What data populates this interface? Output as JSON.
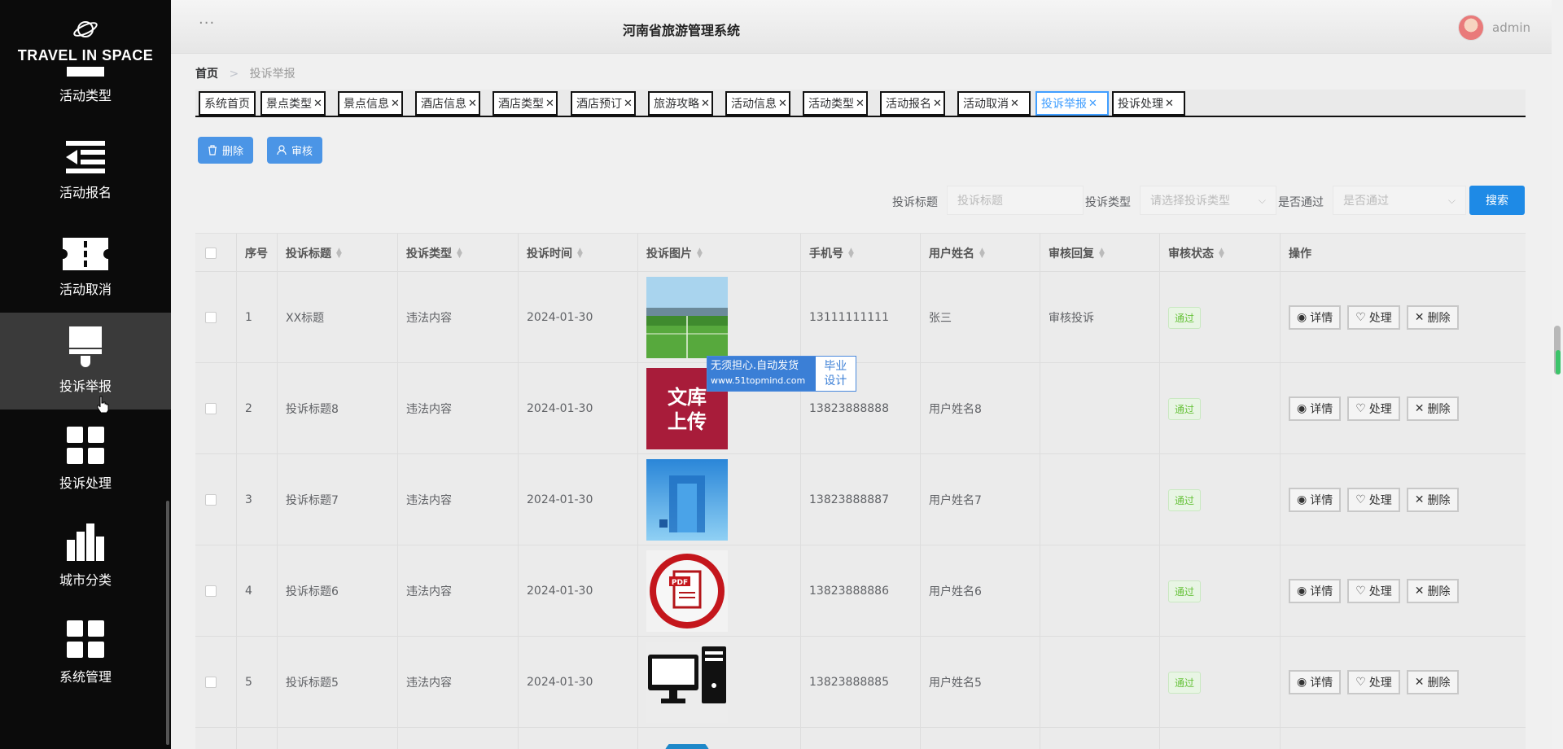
{
  "brand": {
    "name": "TRAVEL IN SPACE"
  },
  "sidebar": {
    "items": [
      {
        "label": "活动类型",
        "icon": "bar-icon"
      },
      {
        "label": "活动报名",
        "icon": "indent-list-icon"
      },
      {
        "label": "活动取消",
        "icon": "ticket-icon"
      },
      {
        "label": "投诉举报",
        "icon": "brush-icon",
        "active": true
      },
      {
        "label": "投诉处理",
        "icon": "grid-icon"
      },
      {
        "label": "城市分类",
        "icon": "bar-chart-icon"
      },
      {
        "label": "系统管理",
        "icon": "grid-icon"
      }
    ]
  },
  "header": {
    "title": "河南省旅游管理系统",
    "user": "admin",
    "menu_glyph": "···"
  },
  "breadcrumb": {
    "home": "首页",
    "separator": ">",
    "current": "投诉举报"
  },
  "tabs": [
    {
      "label": "系统首页",
      "closable": false
    },
    {
      "label": "景点类型",
      "closable": true
    },
    {
      "label": "景点信息",
      "closable": true
    },
    {
      "label": "酒店信息",
      "closable": true
    },
    {
      "label": "酒店类型",
      "closable": true
    },
    {
      "label": "酒店预订",
      "closable": true
    },
    {
      "label": "旅游攻略",
      "closable": true
    },
    {
      "label": "活动信息",
      "closable": true
    },
    {
      "label": "活动类型",
      "closable": true
    },
    {
      "label": "活动报名",
      "closable": true
    },
    {
      "label": "活动取消",
      "closable": true
    },
    {
      "label": "投诉举报",
      "closable": true,
      "active": true
    },
    {
      "label": "投诉处理",
      "closable": true
    }
  ],
  "actions": {
    "delete_label": "删除",
    "review_label": "审核"
  },
  "search": {
    "title_label": "投诉标题",
    "title_placeholder": "投诉标题",
    "type_label": "投诉类型",
    "type_placeholder": "请选择投诉类型",
    "pass_label": "是否通过",
    "pass_placeholder": "是否通过",
    "button_label": "搜索"
  },
  "table": {
    "columns": [
      "序号",
      "投诉标题",
      "投诉类型",
      "投诉时间",
      "投诉图片",
      "手机号",
      "用户姓名",
      "审核回复",
      "审核状态",
      "操作"
    ],
    "rows": [
      {
        "index": "1",
        "title": "XX标题",
        "type": "违法内容",
        "time": "2024-01-30",
        "image": "stadium-image",
        "phone": "13111111111",
        "name": "张三",
        "reply": "审核投诉",
        "status": "通过"
      },
      {
        "index": "2",
        "title": "投诉标题8",
        "type": "违法内容",
        "time": "2024-01-30",
        "image": "wenku-upload-image",
        "image_text": "文库上传",
        "phone": "13823888888",
        "name": "用户姓名8",
        "reply": "",
        "status": "通过"
      },
      {
        "index": "3",
        "title": "投诉标题7",
        "type": "违法内容",
        "time": "2024-01-30",
        "image": "blue-stage-image",
        "phone": "13823888887",
        "name": "用户姓名7",
        "reply": "",
        "status": "通过"
      },
      {
        "index": "4",
        "title": "投诉标题6",
        "type": "违法内容",
        "time": "2024-01-30",
        "image": "pdf-image",
        "image_text": "PDF",
        "phone": "13823888886",
        "name": "用户姓名6",
        "reply": "",
        "status": "通过"
      },
      {
        "index": "5",
        "title": "投诉标题5",
        "type": "违法内容",
        "time": "2024-01-30",
        "image": "computer-image",
        "phone": "13823888885",
        "name": "用户姓名5",
        "reply": "",
        "status": "通过"
      }
    ],
    "ops": {
      "detail": "详情",
      "handle": "处理",
      "delete": "删除"
    }
  },
  "watermark": {
    "line1": "无须担心.自动发货",
    "line2": "www.51topmind.com",
    "right_line1": "毕业",
    "right_line2": "设计"
  },
  "colors": {
    "primary": "#409eff",
    "sidebar_bg": "#0b0b0b",
    "active_item": "#3a3a3a",
    "success": "#67c23a"
  }
}
